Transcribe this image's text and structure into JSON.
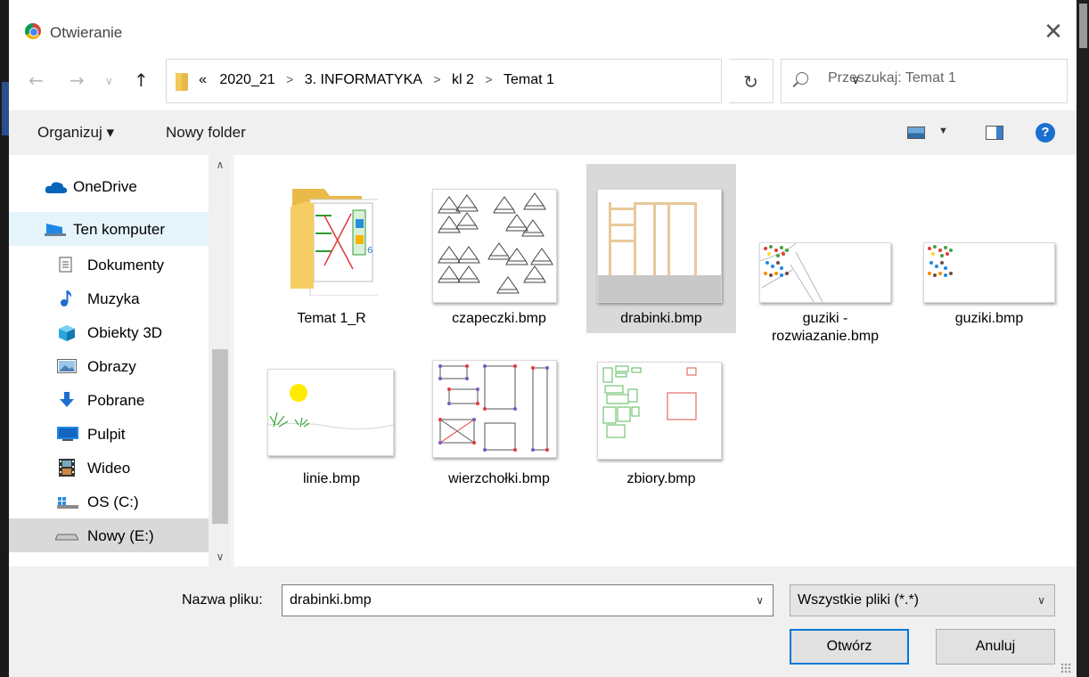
{
  "window": {
    "title": "Otwieranie"
  },
  "address": {
    "overflow": "«",
    "crumbs": [
      "2020_21",
      "3. INFORMATYKA",
      "kl 2",
      "Temat 1"
    ]
  },
  "search": {
    "placeholder": "Przeszukaj: Temat 1"
  },
  "toolbar": {
    "organize_label": "Organizuj ▾",
    "new_folder_label": "Nowy folder"
  },
  "nav": {
    "items": [
      {
        "label": "OneDrive",
        "icon": "cloud-icon"
      },
      {
        "label": "Ten komputer",
        "icon": "computer-icon",
        "state": "highlighted"
      },
      {
        "label": "Dokumenty",
        "icon": "document-icon"
      },
      {
        "label": "Muzyka",
        "icon": "music-icon"
      },
      {
        "label": "Obiekty 3D",
        "icon": "cube-icon"
      },
      {
        "label": "Obrazy",
        "icon": "image-icon"
      },
      {
        "label": "Pobrane",
        "icon": "download-icon"
      },
      {
        "label": "Pulpit",
        "icon": "desktop-icon"
      },
      {
        "label": "Wideo",
        "icon": "video-icon"
      },
      {
        "label": "OS (C:)",
        "icon": "windows-drive-icon"
      },
      {
        "label": "Nowy (E:)",
        "icon": "drive-icon",
        "state": "selected"
      }
    ]
  },
  "files": [
    {
      "name": "Temat 1_R",
      "type": "folder"
    },
    {
      "name": "czapeczki.bmp",
      "type": "image"
    },
    {
      "name": "drabinki.bmp",
      "type": "image",
      "selected": true
    },
    {
      "name": "guziki -\nrozwiazanie.bmp",
      "type": "image"
    },
    {
      "name": "guziki.bmp",
      "type": "image"
    },
    {
      "name": "linie.bmp",
      "type": "image"
    },
    {
      "name": "wierzchołki.bmp",
      "type": "image"
    },
    {
      "name": "zbiory.bmp",
      "type": "image"
    }
  ],
  "footer": {
    "filename_label": "Nazwa pliku:",
    "filename_value": "drabinki.bmp",
    "filter_value": "Wszystkie pliki (*.*)",
    "open_label": "Otwórz",
    "cancel_label": "Anuluj"
  },
  "colors": {
    "selection": "#d9d9d9",
    "hover": "#e5f3fb",
    "accent": "#0078d7"
  }
}
